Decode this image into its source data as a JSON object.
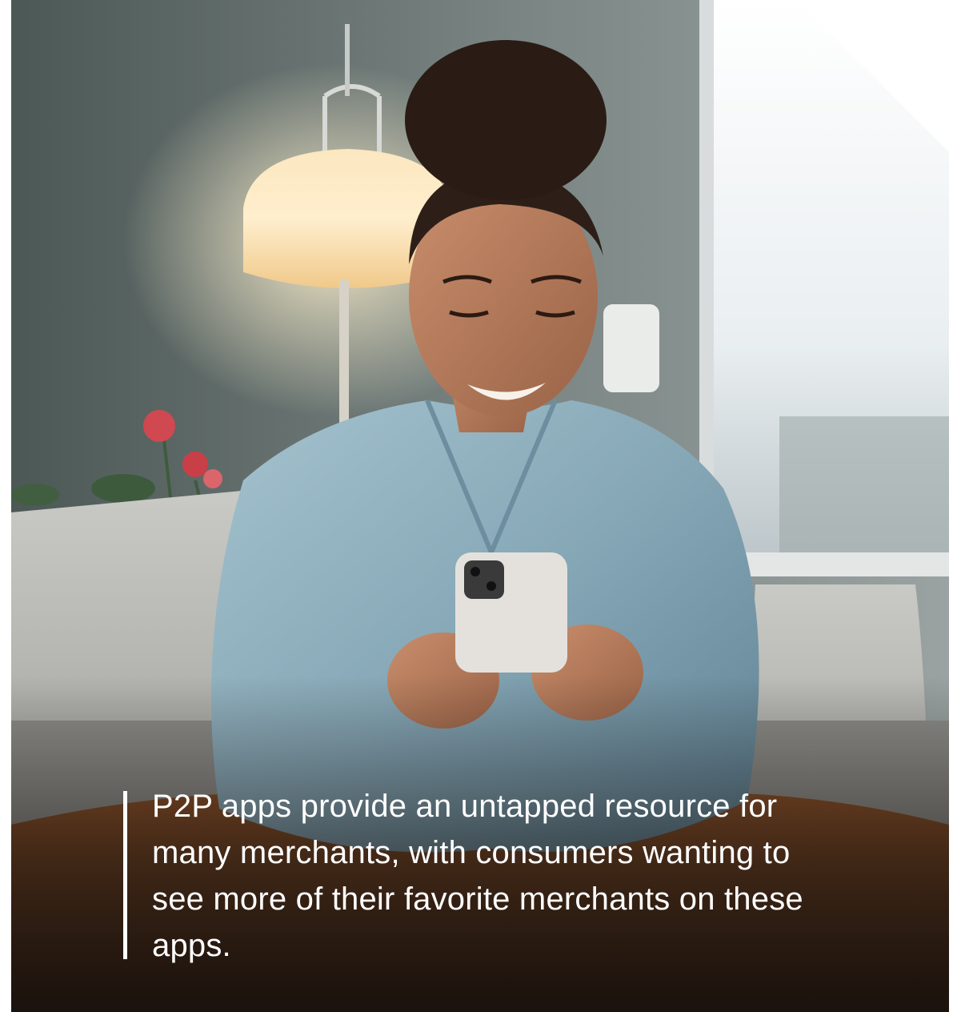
{
  "caption": {
    "text": "P2P apps provide an untapped resource for many merchants, with consumers wanting to see more of their favorite merchants on these apps."
  },
  "colors": {
    "accent_bar": "#ffffff",
    "caption_text": "#ffffff"
  }
}
